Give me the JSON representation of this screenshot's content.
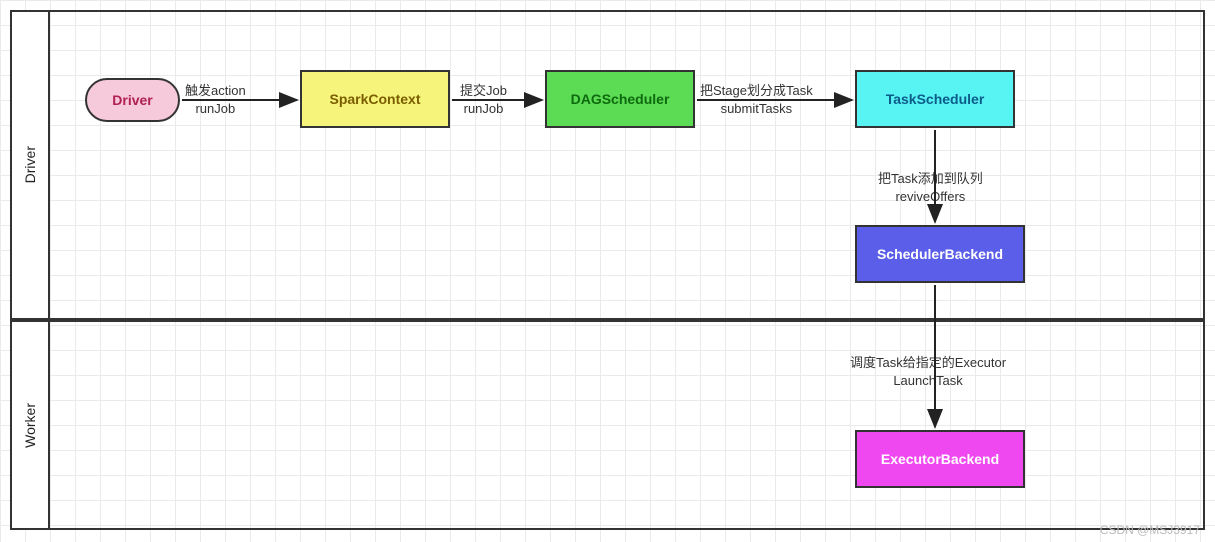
{
  "swimlanes": {
    "driver": "Driver",
    "worker": "Worker"
  },
  "nodes": {
    "driver": "Driver",
    "sparkContext": "SparkContext",
    "dagScheduler": "DAGScheduler",
    "taskScheduler": "TaskScheduler",
    "schedulerBackend": "SchedulerBackend",
    "executorBackend": "ExecutorBackend"
  },
  "edges": {
    "driverToSpark": {
      "line1": "触发action",
      "line2": "runJob"
    },
    "sparkToDag": {
      "line1": "提交Job",
      "line2": "runJob"
    },
    "dagToTask": {
      "line1": "把Stage划分成Task",
      "line2": "submitTasks"
    },
    "taskToSchedBk": {
      "line1": "把Task添加到队列",
      "line2": "reviveOffers"
    },
    "schedBkToExec": {
      "line1": "调度Task给指定的Executor",
      "line2": "LaunchTask"
    }
  },
  "watermark": "CSDN @MSJ3917"
}
